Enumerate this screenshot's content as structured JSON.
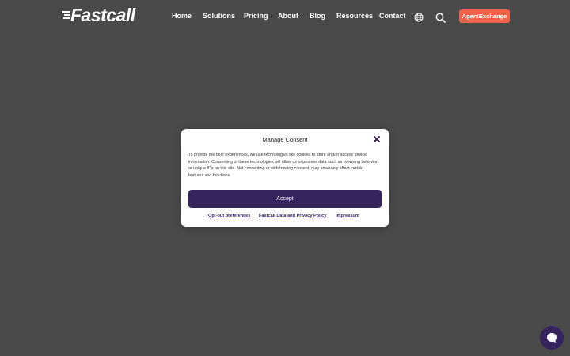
{
  "header": {
    "logo_text": "Fastcall",
    "nav": [
      {
        "label": "Home"
      },
      {
        "label": "Solutions"
      },
      {
        "label": "Pricing"
      },
      {
        "label": "About"
      },
      {
        "label": "Blog"
      },
      {
        "label": "Resources"
      },
      {
        "label": "Contact"
      }
    ],
    "icons": [
      "globe-icon",
      "search-icon"
    ],
    "cta_label": "AgentExchange"
  },
  "consent": {
    "title": "Manage Consent",
    "body": "To provide the best experiences, we use technologies like cookies to store and/or access device information. Consenting to these technologies will allow us to process data such as browsing behavior or unique IDs on this site. Not consenting or withdrawing consent, may adversely affect certain features and functions.",
    "accept_label": "Accept",
    "links": [
      {
        "label": "Opt-out preferences"
      },
      {
        "label": "Fastcall Data and Privacy Policy"
      },
      {
        "label": "Impressum"
      }
    ]
  },
  "chat": {
    "icon": "chat-bubble-icon"
  },
  "colors": {
    "overlay": "#4a4a4a",
    "accent": "#35245e",
    "cta": "#f0634a"
  }
}
